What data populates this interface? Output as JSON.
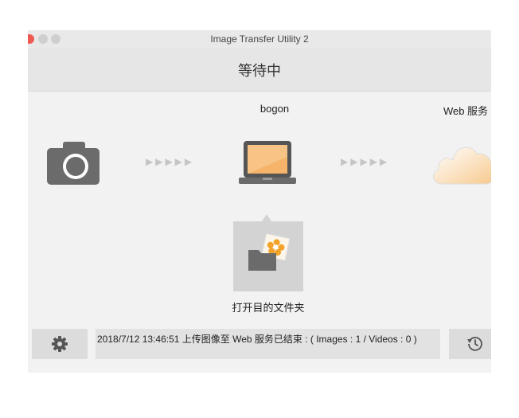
{
  "window": {
    "title": "Image Transfer Utility 2"
  },
  "status": {
    "title": "等待中"
  },
  "devices": {
    "computer_label": "bogon",
    "web_label": "Web 服务"
  },
  "arrows": "▶▶▶▶▶",
  "actions": {
    "open_folder_label": "打开目的文件夹"
  },
  "log": {
    "message": "2018/7/12 13:46:51   上传图像至 Web 服务已结束 : ( Images : 1 / Videos : 0 )"
  },
  "icons": {
    "camera": "camera-icon",
    "computer": "laptop-icon",
    "web": "cloud-icon",
    "folder": "folder-photo-icon",
    "settings": "gear-icon",
    "history": "history-icon"
  },
  "colors": {
    "window_bg": "#f2f2f2",
    "status_bar": "#e6e6e6",
    "icon_gray": "#6b6b6b",
    "laptop_screen": "#f5b46a",
    "folder_flower": "#f4a32a",
    "close_button": "#ee5a52"
  }
}
